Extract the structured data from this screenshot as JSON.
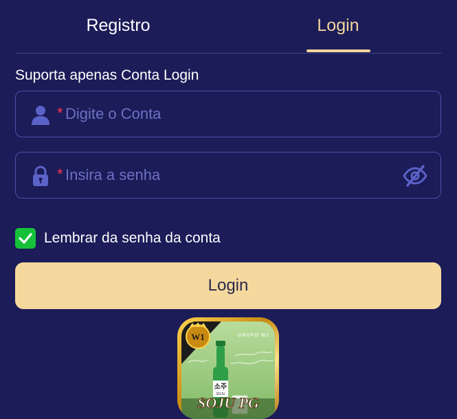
{
  "tabs": {
    "register_label": "Registro",
    "login_label": "Login",
    "active": "login"
  },
  "form": {
    "hint": "Suporta apenas Conta Login",
    "account": {
      "required_mark": "*",
      "placeholder": "Digite o Conta",
      "value": "",
      "icon": "user-icon"
    },
    "password": {
      "required_mark": "*",
      "placeholder": "Insira a senha",
      "value": "",
      "icon": "lock-icon",
      "visibility_icon": "eye-off-icon"
    },
    "remember": {
      "label": "Lembrar da senha da conta",
      "checked": true
    },
    "submit_label": "Login"
  },
  "logo": {
    "top_text": "GRUPO W1",
    "badge_text": "W1",
    "bottle_text": "소주",
    "bottle_subtext": "SOJU",
    "brand_text": "SOJU PG"
  },
  "colors": {
    "background": "#1b1c58",
    "accent": "#f3d59b",
    "button": "#f5d89e",
    "checkbox": "#16c13a",
    "placeholder": "#6c71c4",
    "required": "#ff3352",
    "field_border": "#4c4fa8"
  }
}
